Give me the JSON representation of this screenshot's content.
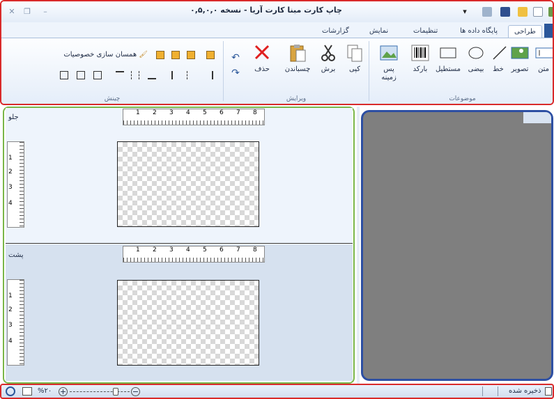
{
  "app": {
    "title": "چاپ کارت مبنا کارت آریا  - نسخه ۰,۵,۰,۰"
  },
  "tabs": [
    {
      "label": "طراحی",
      "active": true
    },
    {
      "label": "پایگاه داده ها",
      "active": false
    },
    {
      "label": "تنظیمات",
      "active": false
    },
    {
      "label": "نمایش",
      "active": false
    },
    {
      "label": "گزارشات",
      "active": false
    }
  ],
  "ribbon": {
    "objects": {
      "group_label": "موضوعات",
      "text": "متن",
      "image": "تصویر",
      "line": "خط",
      "ellipse": "بیضی",
      "rectangle": "مستطیل",
      "barcode": "بارکد",
      "background_line1": "پس",
      "background_line2": "زمینه"
    },
    "edit": {
      "group_label": "ویرایش",
      "copy": "کپی",
      "cut": "برش",
      "paste": "چسباندن",
      "delete": "حذف"
    },
    "arrange": {
      "group_label": "چینش",
      "match_properties": "همسان سازی خصوصیات"
    }
  },
  "design": {
    "front_label": "جلو",
    "back_label": "پشت",
    "ruler_h": [
      "1",
      "2",
      "3",
      "4",
      "5",
      "6",
      "7",
      "8"
    ],
    "ruler_v": [
      "1",
      "2",
      "3",
      "4"
    ]
  },
  "status": {
    "saved": "ذخیره شده",
    "zoom": "%۲۰",
    "zoom_level": 0.8
  },
  "colors": {
    "ribbon_border": "#d92a2a",
    "design_border": "#7ab648",
    "preview_border": "#2d4fa3",
    "preview_bg": "#7f7f7f",
    "accent": "#2b579a"
  }
}
